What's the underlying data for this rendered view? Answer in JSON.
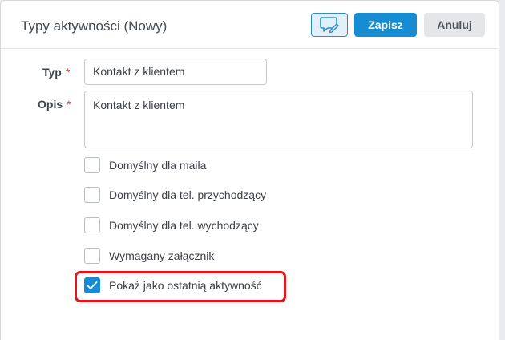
{
  "dialog": {
    "title": "Typy aktywności (Nowy)",
    "buttons": {
      "comment_icon": "comment-edit-icon",
      "save_label": "Zapisz",
      "cancel_label": "Anuluj"
    }
  },
  "form": {
    "type": {
      "label": "Typ",
      "required_mark": "*",
      "value": "Kontakt z klientem"
    },
    "description": {
      "label": "Opis",
      "required_mark": "*",
      "value": "Kontakt z klientem"
    },
    "checkboxes": [
      {
        "label": "Domyślny dla maila",
        "checked": false
      },
      {
        "label": "Domyślny dla tel. przychodzący",
        "checked": false
      },
      {
        "label": "Domyślny dla tel. wychodzący",
        "checked": false
      },
      {
        "label": "Wymagany załącznik",
        "checked": false
      },
      {
        "label": "Pokaż jako ostatnią aktywność",
        "checked": true,
        "highlighted": true
      }
    ]
  },
  "colors": {
    "primary": "#168dd3",
    "required": "#e0312e",
    "highlight": "#e3151c"
  }
}
